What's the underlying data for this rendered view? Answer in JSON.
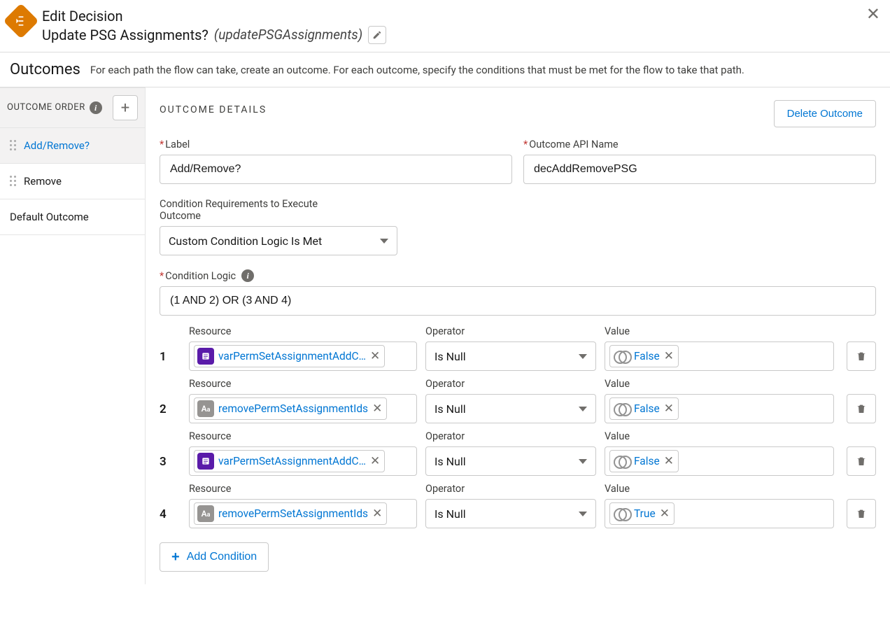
{
  "header": {
    "title": "Edit Decision",
    "name": "Update PSG Assignments?",
    "api": "(updatePSGAssignments)"
  },
  "outcomes_bar": {
    "title": "Outcomes",
    "desc": "For each path the flow can take, create an outcome. For each outcome, specify the conditions that must be met for the flow to take that path."
  },
  "sidebar": {
    "order_label": "OUTCOME ORDER",
    "items": [
      {
        "label": "Add/Remove?",
        "selected": true,
        "draggable": true
      },
      {
        "label": "Remove",
        "selected": false,
        "draggable": true
      },
      {
        "label": "Default Outcome",
        "selected": false,
        "draggable": false
      }
    ]
  },
  "details": {
    "section_title": "OUTCOME DETAILS",
    "delete_btn": "Delete Outcome",
    "label_lbl": "Label",
    "label_val": "Add/Remove?",
    "api_lbl": "Outcome API Name",
    "api_val": "decAddRemovePSG",
    "cond_req_lbl": "Condition Requirements to Execute Outcome",
    "cond_req_val": "Custom Condition Logic Is Met",
    "cond_logic_lbl": "Condition Logic",
    "cond_logic_val": "(1 AND 2) OR (3 AND 4)",
    "col_resource": "Resource",
    "col_operator": "Operator",
    "col_value": "Value",
    "add_condition": "Add Condition",
    "conditions": [
      {
        "n": "1",
        "resource": "varPermSetAssignmentAddC…",
        "resourceIcon": "record",
        "operator": "Is Null",
        "value": "False"
      },
      {
        "n": "2",
        "resource": "removePermSetAssignmentIds",
        "resourceIcon": "text",
        "operator": "Is Null",
        "value": "False"
      },
      {
        "n": "3",
        "resource": "varPermSetAssignmentAddC…",
        "resourceIcon": "record",
        "operator": "Is Null",
        "value": "False"
      },
      {
        "n": "4",
        "resource": "removePermSetAssignmentIds",
        "resourceIcon": "text",
        "operator": "Is Null",
        "value": "True"
      }
    ]
  }
}
